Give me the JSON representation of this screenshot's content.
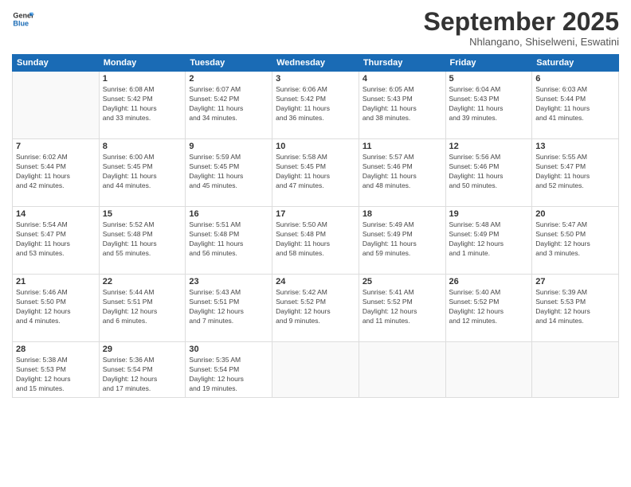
{
  "logo": {
    "line1": "General",
    "line2": "Blue"
  },
  "header": {
    "title": "September 2025",
    "subtitle": "Nhlangano, Shiselweni, Eswatini"
  },
  "days_of_week": [
    "Sunday",
    "Monday",
    "Tuesday",
    "Wednesday",
    "Thursday",
    "Friday",
    "Saturday"
  ],
  "weeks": [
    [
      {
        "day": "",
        "info": ""
      },
      {
        "day": "1",
        "info": "Sunrise: 6:08 AM\nSunset: 5:42 PM\nDaylight: 11 hours\nand 33 minutes."
      },
      {
        "day": "2",
        "info": "Sunrise: 6:07 AM\nSunset: 5:42 PM\nDaylight: 11 hours\nand 34 minutes."
      },
      {
        "day": "3",
        "info": "Sunrise: 6:06 AM\nSunset: 5:42 PM\nDaylight: 11 hours\nand 36 minutes."
      },
      {
        "day": "4",
        "info": "Sunrise: 6:05 AM\nSunset: 5:43 PM\nDaylight: 11 hours\nand 38 minutes."
      },
      {
        "day": "5",
        "info": "Sunrise: 6:04 AM\nSunset: 5:43 PM\nDaylight: 11 hours\nand 39 minutes."
      },
      {
        "day": "6",
        "info": "Sunrise: 6:03 AM\nSunset: 5:44 PM\nDaylight: 11 hours\nand 41 minutes."
      }
    ],
    [
      {
        "day": "7",
        "info": "Sunrise: 6:02 AM\nSunset: 5:44 PM\nDaylight: 11 hours\nand 42 minutes."
      },
      {
        "day": "8",
        "info": "Sunrise: 6:00 AM\nSunset: 5:45 PM\nDaylight: 11 hours\nand 44 minutes."
      },
      {
        "day": "9",
        "info": "Sunrise: 5:59 AM\nSunset: 5:45 PM\nDaylight: 11 hours\nand 45 minutes."
      },
      {
        "day": "10",
        "info": "Sunrise: 5:58 AM\nSunset: 5:45 PM\nDaylight: 11 hours\nand 47 minutes."
      },
      {
        "day": "11",
        "info": "Sunrise: 5:57 AM\nSunset: 5:46 PM\nDaylight: 11 hours\nand 48 minutes."
      },
      {
        "day": "12",
        "info": "Sunrise: 5:56 AM\nSunset: 5:46 PM\nDaylight: 11 hours\nand 50 minutes."
      },
      {
        "day": "13",
        "info": "Sunrise: 5:55 AM\nSunset: 5:47 PM\nDaylight: 11 hours\nand 52 minutes."
      }
    ],
    [
      {
        "day": "14",
        "info": "Sunrise: 5:54 AM\nSunset: 5:47 PM\nDaylight: 11 hours\nand 53 minutes."
      },
      {
        "day": "15",
        "info": "Sunrise: 5:52 AM\nSunset: 5:48 PM\nDaylight: 11 hours\nand 55 minutes."
      },
      {
        "day": "16",
        "info": "Sunrise: 5:51 AM\nSunset: 5:48 PM\nDaylight: 11 hours\nand 56 minutes."
      },
      {
        "day": "17",
        "info": "Sunrise: 5:50 AM\nSunset: 5:48 PM\nDaylight: 11 hours\nand 58 minutes."
      },
      {
        "day": "18",
        "info": "Sunrise: 5:49 AM\nSunset: 5:49 PM\nDaylight: 11 hours\nand 59 minutes."
      },
      {
        "day": "19",
        "info": "Sunrise: 5:48 AM\nSunset: 5:49 PM\nDaylight: 12 hours\nand 1 minute."
      },
      {
        "day": "20",
        "info": "Sunrise: 5:47 AM\nSunset: 5:50 PM\nDaylight: 12 hours\nand 3 minutes."
      }
    ],
    [
      {
        "day": "21",
        "info": "Sunrise: 5:46 AM\nSunset: 5:50 PM\nDaylight: 12 hours\nand 4 minutes."
      },
      {
        "day": "22",
        "info": "Sunrise: 5:44 AM\nSunset: 5:51 PM\nDaylight: 12 hours\nand 6 minutes."
      },
      {
        "day": "23",
        "info": "Sunrise: 5:43 AM\nSunset: 5:51 PM\nDaylight: 12 hours\nand 7 minutes."
      },
      {
        "day": "24",
        "info": "Sunrise: 5:42 AM\nSunset: 5:52 PM\nDaylight: 12 hours\nand 9 minutes."
      },
      {
        "day": "25",
        "info": "Sunrise: 5:41 AM\nSunset: 5:52 PM\nDaylight: 12 hours\nand 11 minutes."
      },
      {
        "day": "26",
        "info": "Sunrise: 5:40 AM\nSunset: 5:52 PM\nDaylight: 12 hours\nand 12 minutes."
      },
      {
        "day": "27",
        "info": "Sunrise: 5:39 AM\nSunset: 5:53 PM\nDaylight: 12 hours\nand 14 minutes."
      }
    ],
    [
      {
        "day": "28",
        "info": "Sunrise: 5:38 AM\nSunset: 5:53 PM\nDaylight: 12 hours\nand 15 minutes."
      },
      {
        "day": "29",
        "info": "Sunrise: 5:36 AM\nSunset: 5:54 PM\nDaylight: 12 hours\nand 17 minutes."
      },
      {
        "day": "30",
        "info": "Sunrise: 5:35 AM\nSunset: 5:54 PM\nDaylight: 12 hours\nand 19 minutes."
      },
      {
        "day": "",
        "info": ""
      },
      {
        "day": "",
        "info": ""
      },
      {
        "day": "",
        "info": ""
      },
      {
        "day": "",
        "info": ""
      }
    ]
  ]
}
